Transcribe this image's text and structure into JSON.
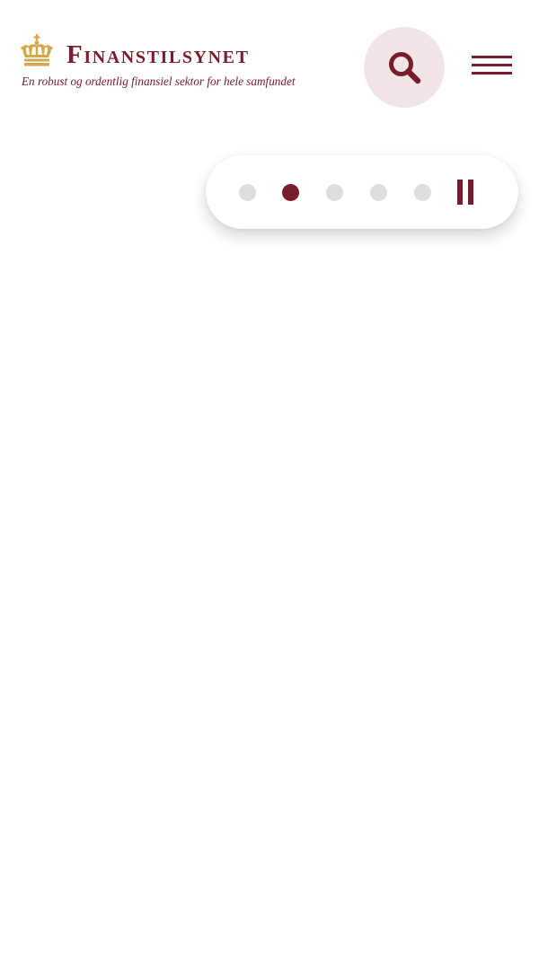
{
  "brand": {
    "name_initial": "F",
    "name_rest": "INANSTILSYNET",
    "tagline": "En robust og ordentlig finansiel sektor for hele samfundet",
    "logo_icon": "crown-icon"
  },
  "header": {
    "search_icon": "search-icon",
    "menu_icon": "hamburger-menu-icon"
  },
  "carousel": {
    "slide_count": 5,
    "active_slide": 2,
    "control_icon": "pause-icon"
  },
  "colors": {
    "brand": "#7a1c2b",
    "gold": "#d4a94e",
    "search_bg": "#f2e5e7",
    "dot_inactive": "#dedede",
    "background": "#ffffff"
  }
}
